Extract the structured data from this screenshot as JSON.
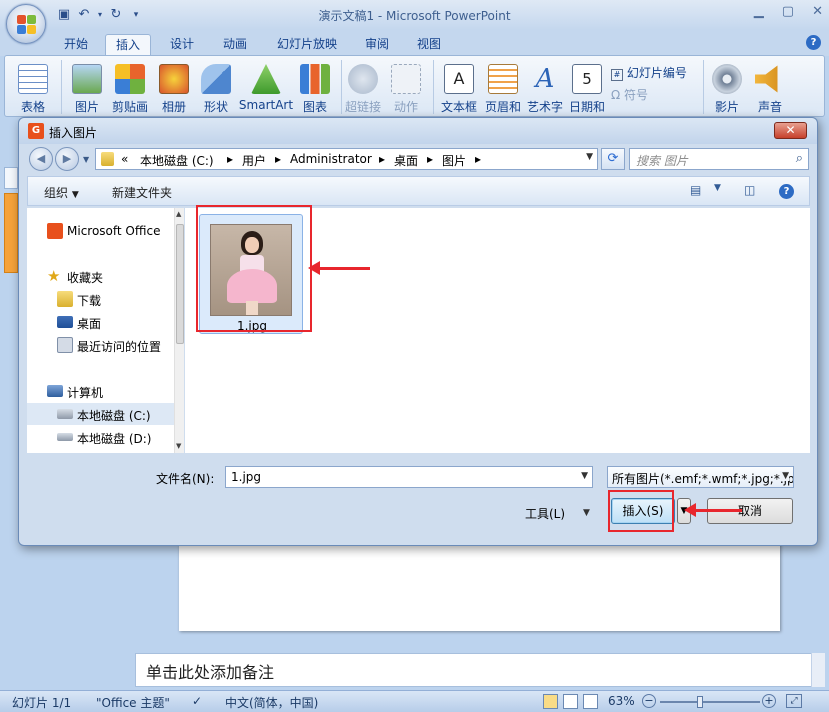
{
  "app": {
    "title": "演示文稿1 - Microsoft PowerPoint",
    "tabs": [
      "开始",
      "插入",
      "设计",
      "动画",
      "幻灯片放映",
      "审阅",
      "视图"
    ],
    "active_tab": "插入"
  },
  "ribbon": {
    "buttons": [
      "表格",
      "图片",
      "剪贴画",
      "相册",
      "形状",
      "SmartArt",
      "图表",
      "超链接",
      "动作",
      "文本框",
      "页眉和",
      "艺术字",
      "日期和",
      "影片",
      "声音"
    ],
    "small": [
      "幻灯片编号",
      "符号"
    ]
  },
  "dialog": {
    "title": "插入图片",
    "breadcrumb": [
      "«",
      "本地磁盘 (C:)",
      "用户",
      "Administrator",
      "桌面",
      "图片"
    ],
    "search_placeholder": "搜索 图片",
    "toolbar": {
      "organize": "组织",
      "new_folder": "新建文件夹"
    },
    "nav": {
      "office": "Microsoft Office",
      "favorites": "收藏夹",
      "downloads": "下载",
      "desktop": "桌面",
      "recent": "最近访问的位置",
      "computer": "计算机",
      "drive_c": "本地磁盘 (C:)",
      "drive_d": "本地磁盘 (D:)"
    },
    "file": {
      "name": "1.jpg"
    },
    "filename_label": "文件名(N):",
    "filename_value": "1.jpg",
    "filetype": "所有图片(*.emf;*.wmf;*.jpg;*.jp",
    "tools_label": "工具(L)",
    "insert_label": "插入(S)",
    "cancel_label": "取消"
  },
  "notes": {
    "placeholder": "单击此处添加备注"
  },
  "status": {
    "slide": "幻灯片 1/1",
    "theme": "\"Office 主题\"",
    "language": "中文(简体，中国)",
    "zoom": "63%"
  },
  "colors": {
    "highlight": "#e8262d",
    "accent": "#15428b"
  }
}
